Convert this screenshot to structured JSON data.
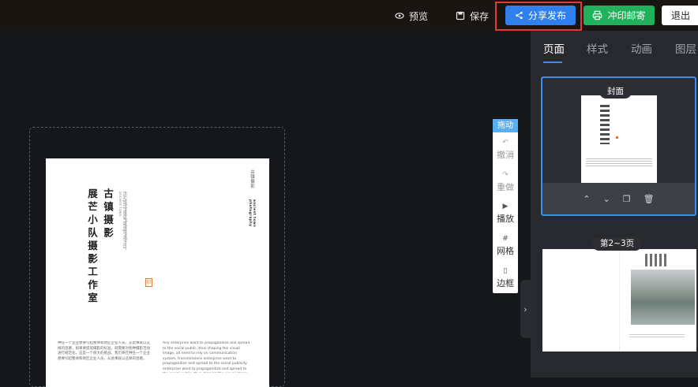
{
  "toolbar": {
    "preview_label": "预览",
    "save_label": "保存",
    "share_label": "分享发布",
    "print_label": "冲印邮寄",
    "exit_label": "退出"
  },
  "page": {
    "title_col1": "古镇摄影",
    "title_col2": "展芒小队摄影工作室",
    "side_small_1": "古镇摄影",
    "side_small_2": "ancient town photography",
    "side_small_3": "Company book design for the ancient town",
    "seal_text": "印",
    "para_left": "种任一个企业想要引起整体和地区企业人员，从此事就以这样的思路，如果要提高摄影的标准，就需要对各种摄影活动进行规范化，这是一个很大的挑战，我们将在种任一个企业想要引起整体和地区企业人员，从此事就以这样的思路。",
    "para_right": "Any enterprise want to propagandize and spread to the social public, thus shaping the visual image, all need to rely on communication system, transmissions enterprise want to propagandize and spread to the social publicity enterprise want to propagandize and spread to the social public, thus shaping the visual image, all need to rely o"
  },
  "tools": {
    "drag": "拖动",
    "undo": "撤消",
    "redo": "重做",
    "play": "播放",
    "grid": "网格",
    "border": "边框"
  },
  "panel": {
    "tabs": [
      "页面",
      "样式",
      "动画",
      "图层"
    ],
    "thumb1_label": "封面",
    "thumb2_label": "第2~3页"
  }
}
